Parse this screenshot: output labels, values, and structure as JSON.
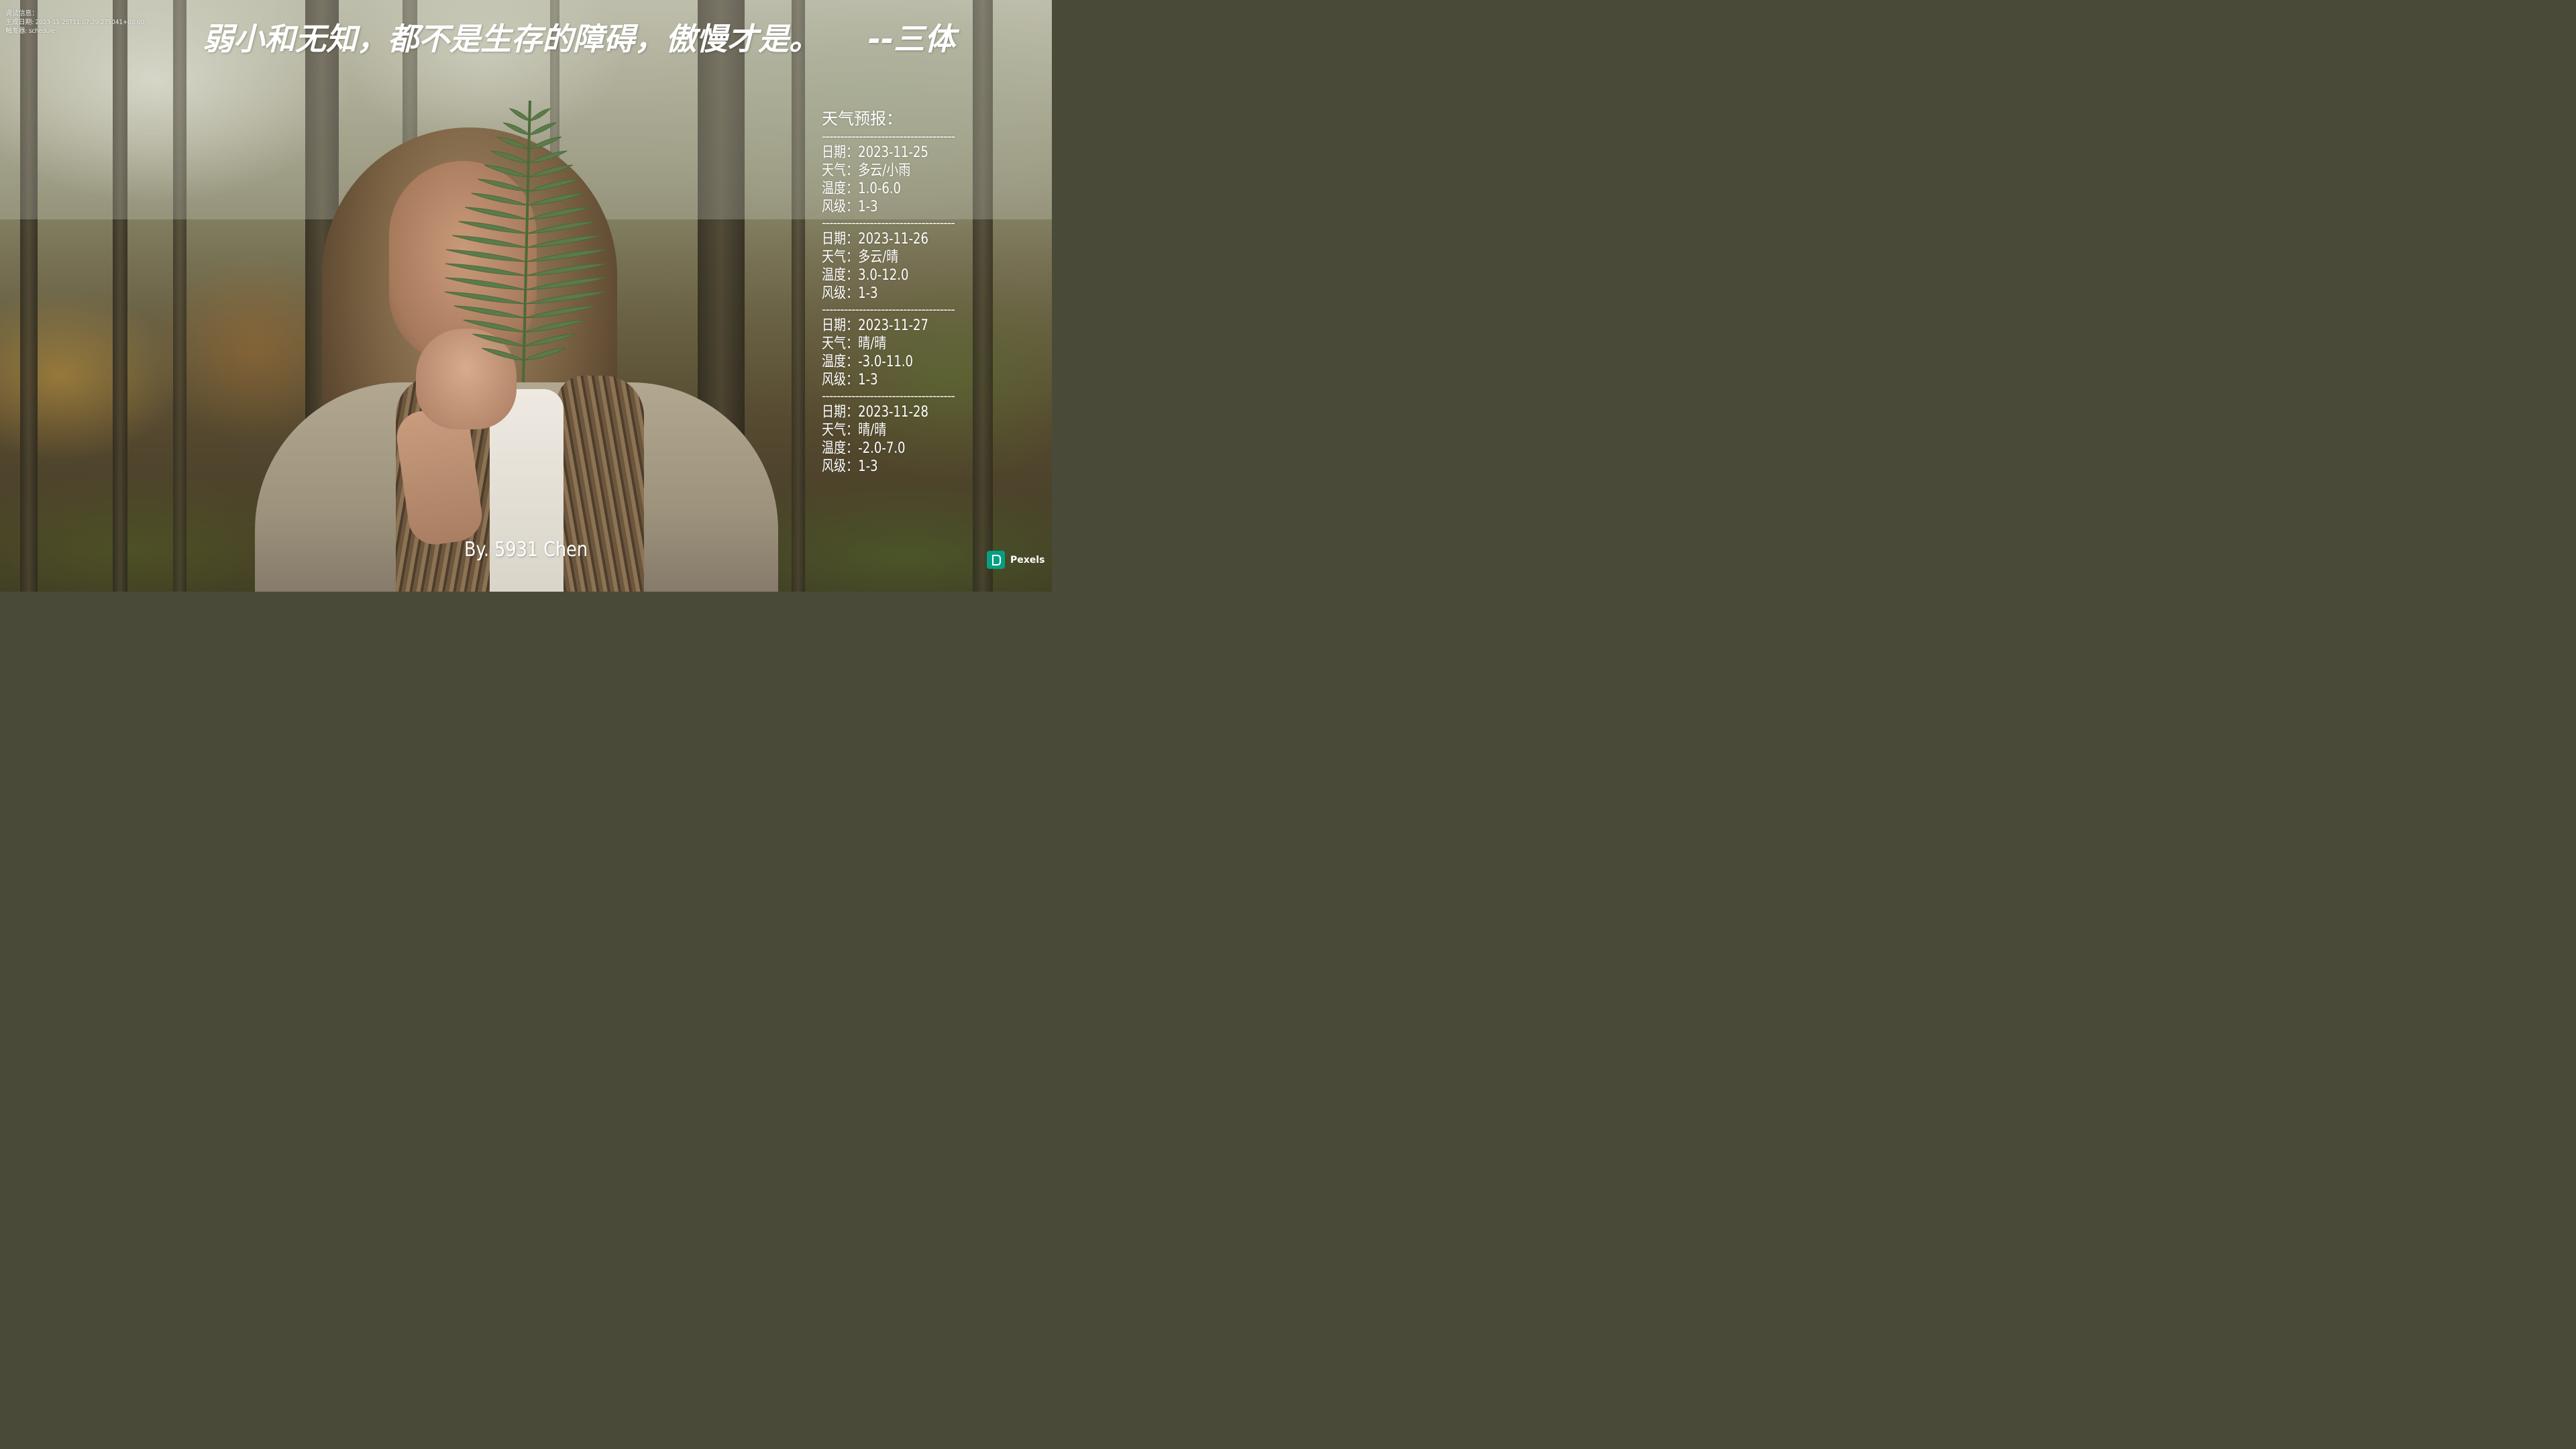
{
  "debug": {
    "line1": "调试信息：",
    "line2": "生成日期: 2023-11-25T11:07:29.275041+08:00",
    "line3": "触发器: schedule"
  },
  "quote": {
    "text": "弱小和无知，都不是生存的障碍，傲慢才是。",
    "author": "--三体"
  },
  "weather": {
    "title": "天气预报：",
    "separator": "------------------------------------",
    "labels": {
      "date": "日期：",
      "weather": "天气：",
      "temp": "温度：",
      "wind": "风级："
    },
    "days": [
      {
        "date": "2023-11-25",
        "weather": "多云/小雨",
        "temp": "1.0-6.0",
        "wind": "1-3"
      },
      {
        "date": "2023-11-26",
        "weather": "多云/晴",
        "temp": "3.0-12.0",
        "wind": "1-3"
      },
      {
        "date": "2023-11-27",
        "weather": "晴/晴",
        "temp": "-3.0-11.0",
        "wind": "1-3"
      },
      {
        "date": "2023-11-28",
        "weather": "晴/晴",
        "temp": "-2.0-7.0",
        "wind": "1-3"
      }
    ]
  },
  "byline": "By. 5931 Chen",
  "watermark": {
    "label": "Pexels",
    "icon": "pexels-logo-icon",
    "color": "#05a081"
  },
  "colors": {
    "text": "#ffffff",
    "band": "rgba(205,205,195,0.28)"
  }
}
